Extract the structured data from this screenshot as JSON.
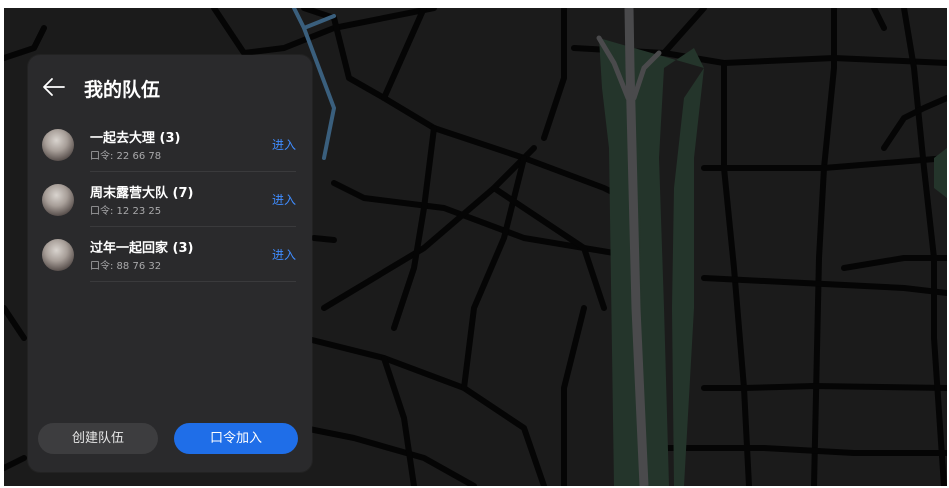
{
  "panel": {
    "title": "我的队伍",
    "teams": [
      {
        "name": "一起去大理 (3)",
        "code": "口令: 22 66 78",
        "action": "进入"
      },
      {
        "name": "周末露营大队 (7)",
        "code": "口令: 12 23 25",
        "action": "进入"
      },
      {
        "name": "过年一起回家 (3)",
        "code": "口令: 88 76 32",
        "action": "进入"
      }
    ],
    "create_button": "创建队伍",
    "join_button": "口令加入"
  },
  "icons": {
    "back": "back-arrow-icon",
    "avatar": "user-avatar"
  },
  "colors": {
    "map_background": "#1b1b1b",
    "road": "#050505",
    "river": "#3a5f7d",
    "panel_background": "#2a2a2c",
    "accent": "#3f8cff",
    "primary_button": "#1f6ee8",
    "secondary_button": "#3d3d3f",
    "park": "#24352b",
    "highway": "#4a4a4c"
  }
}
